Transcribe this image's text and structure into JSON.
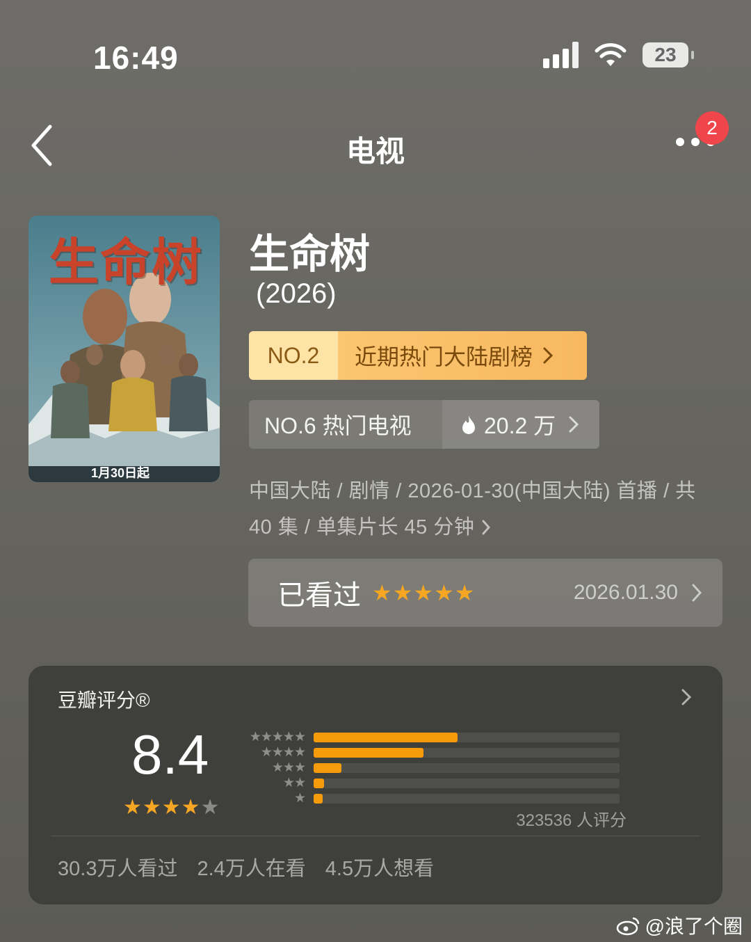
{
  "status_bar": {
    "time": "16:49",
    "battery": "23"
  },
  "nav": {
    "title": "电视",
    "badge_count": "2"
  },
  "show": {
    "poster_title": "生命树",
    "poster_date": "1月30日起",
    "title": "生命树",
    "year": "(2026)"
  },
  "ranks": {
    "primary": {
      "number": "NO.2",
      "label": "近期热门大陆剧榜"
    },
    "secondary": {
      "label": "NO.6 热门电视",
      "heat": "20.2 万"
    }
  },
  "meta": {
    "line1": "中国大陆 / 剧情 / 2026-01-30(中国大陆) 首播 / 共",
    "line2": "40 集 / 单集片长 45 分钟"
  },
  "watched": {
    "label": "已看过",
    "stars": 5,
    "date": "2026.01.30"
  },
  "rating": {
    "title": "豆瓣评分®",
    "score": "8.4",
    "star_level": 4,
    "count": "323536 人评分",
    "distribution": [
      {
        "stars": "★★★★★",
        "fraction": 0.47
      },
      {
        "stars": "★★★★",
        "fraction": 0.36
      },
      {
        "stars": "★★★",
        "fraction": 0.09
      },
      {
        "stars": "★★",
        "fraction": 0.035
      },
      {
        "stars": "★",
        "fraction": 0.03
      }
    ],
    "stats": [
      "30.3万人看过",
      "2.4万人在看",
      "4.5万人想看"
    ]
  },
  "watermark": "@浪了个圈",
  "colors": {
    "accent_star": "#f5a623",
    "bar_fill": "#f59b0c",
    "badge": "#f0454a",
    "rank_gold": "#fbc671"
  },
  "icons": [
    "back-chevron-icon",
    "more-dots-icon",
    "flame-icon",
    "chevron-right-icon",
    "weibo-icon",
    "wifi-icon",
    "signal-icon",
    "battery-icon"
  ]
}
